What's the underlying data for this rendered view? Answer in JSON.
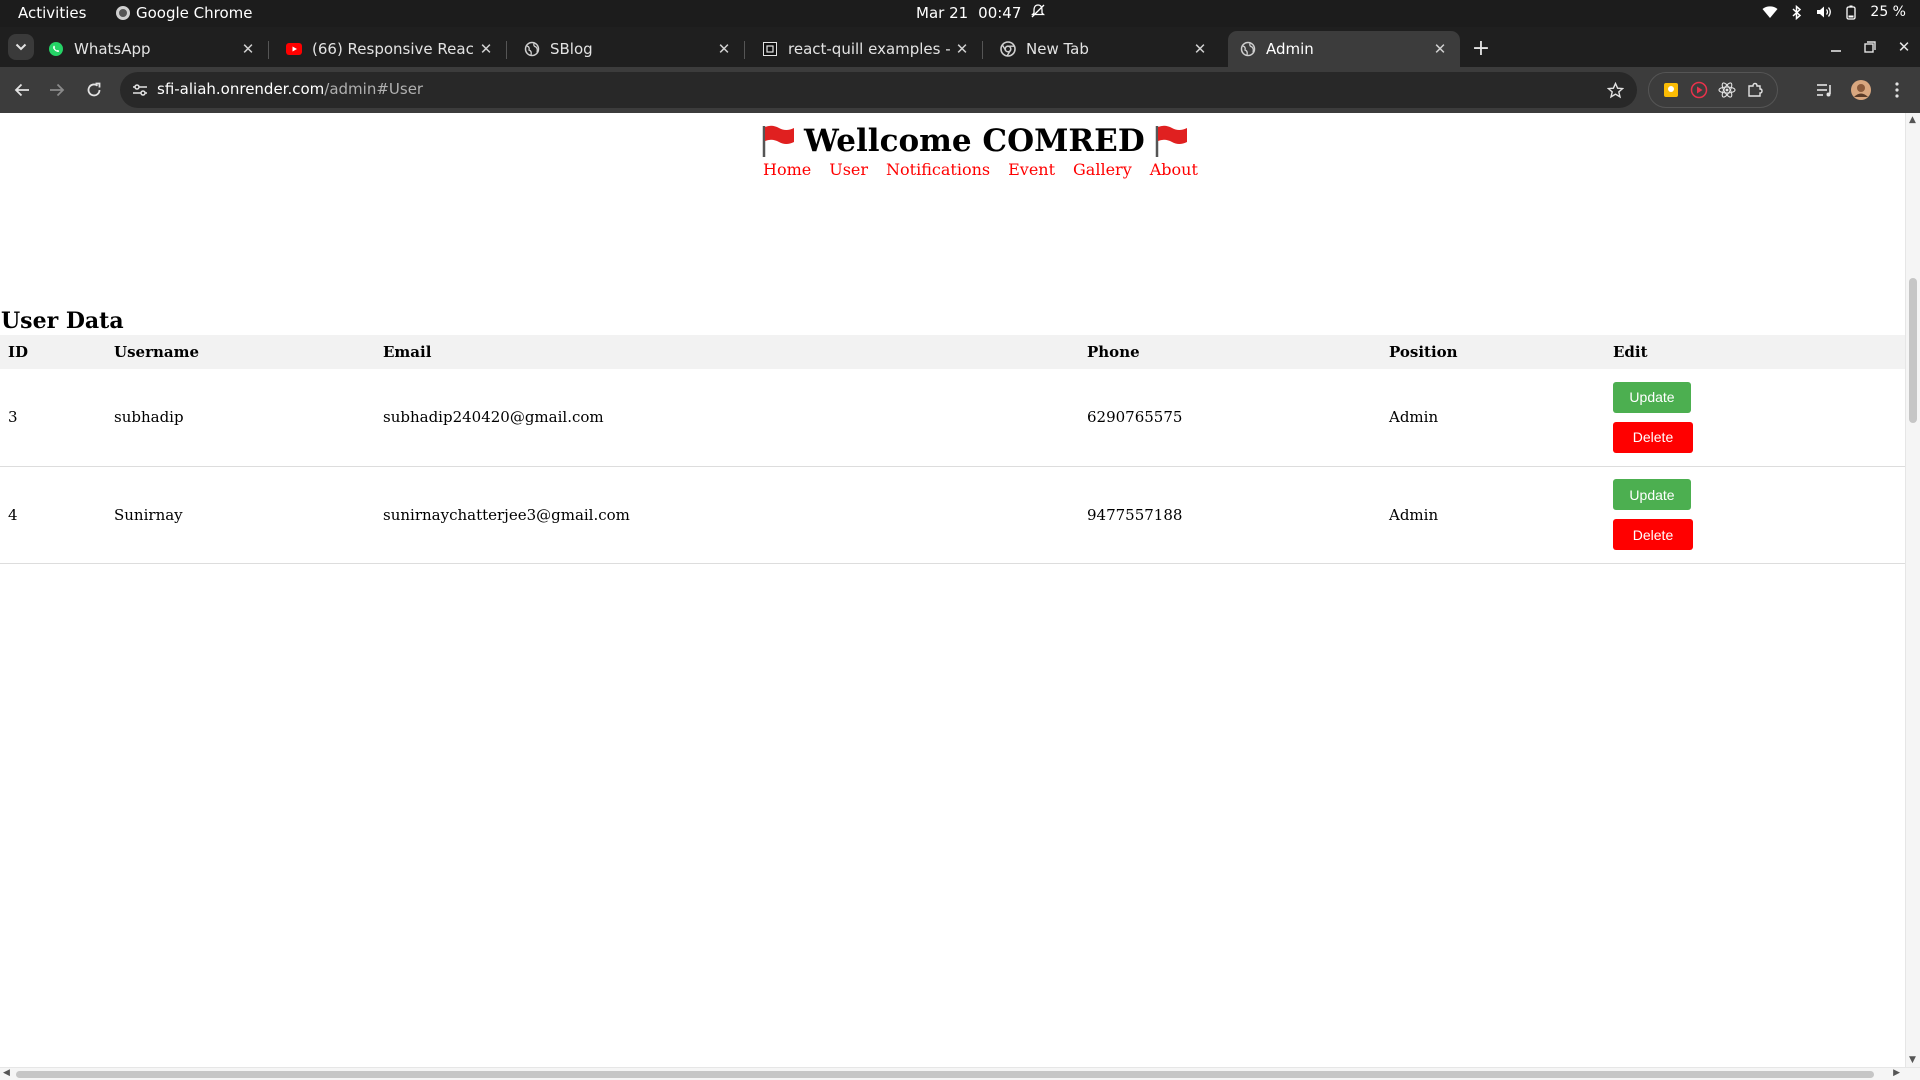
{
  "system_bar": {
    "activities": "Activities",
    "app_name": "Google Chrome",
    "date": "Mar 21",
    "time": "00:47",
    "battery": "25 %"
  },
  "tabs": [
    {
      "title": "WhatsApp",
      "icon": "whatsapp-icon"
    },
    {
      "title": "(66) Responsive React Bl",
      "icon": "youtube-icon"
    },
    {
      "title": "SBlog",
      "icon": "globe-icon"
    },
    {
      "title": "react-quill examples - Co",
      "icon": "codesandbox-icon"
    },
    {
      "title": "New Tab",
      "icon": "chrome-icon"
    },
    {
      "title": "Admin",
      "icon": "globe-icon",
      "active": true
    }
  ],
  "address_bar": {
    "host": "sfi-aliah.onrender.com",
    "path": "/admin#User"
  },
  "site": {
    "title": "Wellcome COMRED",
    "nav": [
      "Home",
      "User",
      "Notifications",
      "Event",
      "Gallery",
      "About"
    ],
    "nav_color": "#ff0000"
  },
  "user_table": {
    "section_title": "User Data",
    "headers": [
      "ID",
      "Username",
      "Email",
      "Phone",
      "Position",
      "Edit"
    ],
    "rows": [
      {
        "id": "3",
        "username": "subhadip",
        "email": "subhadip240420@gmail.com",
        "phone": "6290765575",
        "position": "Admin"
      },
      {
        "id": "4",
        "username": "Sunirnay",
        "email": "sunirnaychatterjee3@gmail.com",
        "phone": "9477557188",
        "position": "Admin"
      }
    ],
    "update_label": "Update",
    "delete_label": "Delete",
    "update_color": "#4caf50",
    "delete_color": "#ff0000"
  }
}
